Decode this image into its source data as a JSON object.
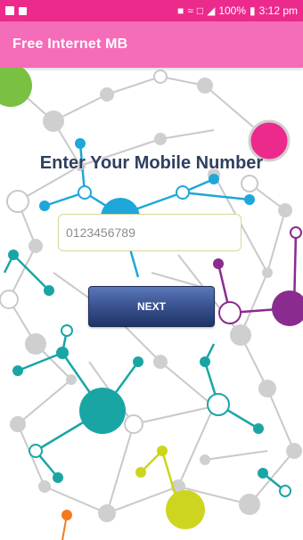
{
  "status_bar": {
    "battery": "100%",
    "time": "3:12 pm"
  },
  "app_bar": {
    "title": "Free Internet MB"
  },
  "form": {
    "heading": "Enter Your Mobile Number",
    "phone_placeholder": "0123456789",
    "phone_value": "",
    "next_label": "NEXT"
  },
  "colors": {
    "status_bar": "#ec2a8c",
    "app_bar": "#f56cb8",
    "heading": "#2e3f60",
    "button": "#3c5593"
  },
  "icons": [
    "image-icon",
    "facebook-icon",
    "lock-icon",
    "wifi-icon",
    "no-sim-icon",
    "signal-icon",
    "battery-icon"
  ]
}
